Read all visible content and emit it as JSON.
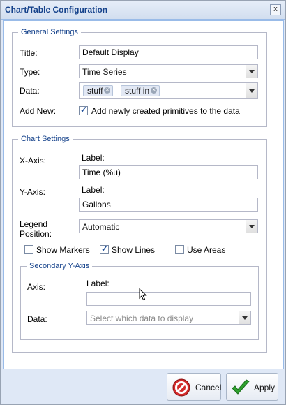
{
  "window": {
    "title": "Chart/Table Configuration",
    "close_label": "x"
  },
  "general": {
    "legend": "General Settings",
    "title_label": "Title:",
    "title_value": "Default Display",
    "type_label": "Type:",
    "type_value": "Time Series",
    "data_label": "Data:",
    "data_tags": [
      "stuff",
      "stuff in"
    ],
    "add_new_label": "Add New:",
    "add_new_checkbox_text": "Add newly created primitives to the data",
    "add_new_checked": true
  },
  "chart": {
    "legend": "Chart Settings",
    "x_axis_label": "X-Axis:",
    "x_label_caption": "Label:",
    "x_label_value": "Time (%u)",
    "y_axis_label": "Y-Axis:",
    "y_label_caption": "Label:",
    "y_label_value": "Gallons",
    "legend_position_label_1": "Legend",
    "legend_position_label_2": "Position:",
    "legend_position_value": "Automatic",
    "show_markers_label": "Show Markers",
    "show_markers_checked": false,
    "show_lines_label": "Show Lines",
    "show_lines_checked": true,
    "use_areas_label": "Use Areas",
    "use_areas_checked": false
  },
  "secondary": {
    "legend": "Secondary Y-Axis",
    "axis_label": "Axis:",
    "label_caption": "Label:",
    "label_value": "",
    "data_label": "Data:",
    "data_placeholder": "Select which data to display"
  },
  "footer": {
    "cancel_label": "Cancel",
    "apply_label": "Apply"
  },
  "colors": {
    "title_text": "#15428b",
    "cancel_icon": "#cc2222",
    "apply_icon": "#2c9b2c"
  }
}
